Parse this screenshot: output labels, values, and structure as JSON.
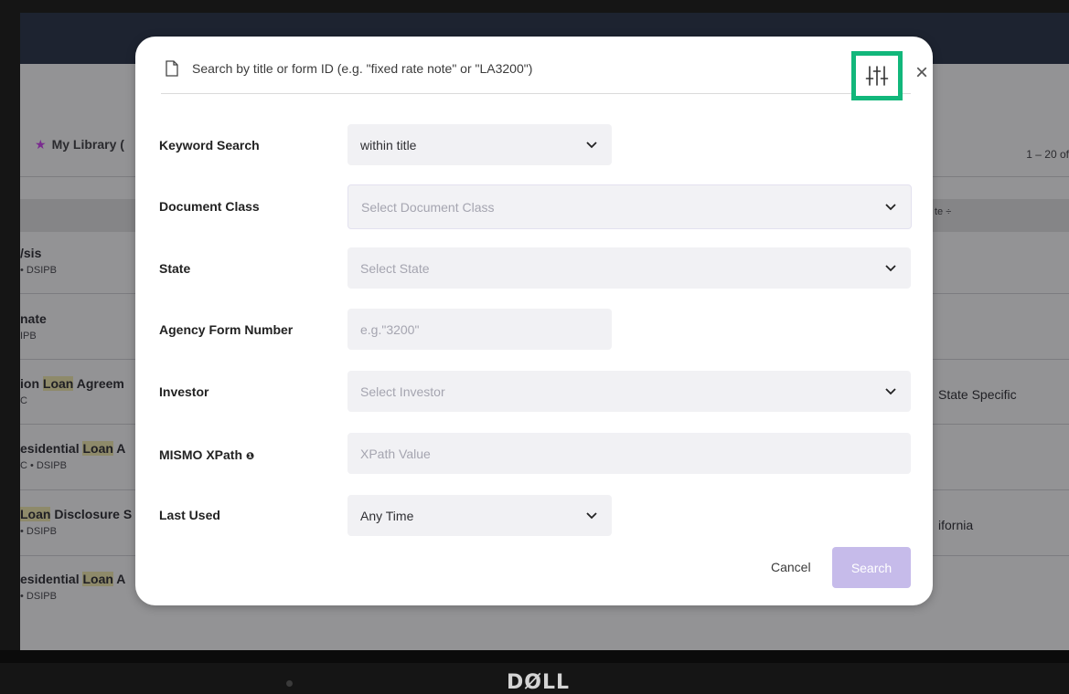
{
  "background": {
    "library_tab": {
      "star": "★",
      "label": "My Library ("
    },
    "pagination": "1 – 20 of",
    "column_header_right": "te ÷",
    "rows": [
      {
        "title_pre": "/sis",
        "title_hl": "",
        "title_post": "",
        "sub": "• DSIPB",
        "right": ""
      },
      {
        "title_pre": "nate",
        "title_hl": "",
        "title_post": "",
        "sub": "IPB",
        "right": ""
      },
      {
        "title_pre": "ion ",
        "title_hl": "Loan",
        "title_post": " Agreem",
        "sub": "C",
        "right": "State Specific"
      },
      {
        "title_pre": "esidential ",
        "title_hl": "Loan",
        "title_post": " A",
        "sub": "C • DSIPB",
        "right": ""
      },
      {
        "title_pre": "",
        "title_hl": "Loan",
        "title_post": " Disclosure S",
        "sub": "• DSIPB",
        "right": "ifornia"
      },
      {
        "title_pre": "esidential ",
        "title_hl": "Loan",
        "title_post": " A",
        "sub": "• DSIPB",
        "right": ""
      }
    ],
    "brand": "DØLL"
  },
  "modal": {
    "search_placeholder": "Search by title or form ID (e.g. \"fixed rate note\" or \"LA3200\")",
    "filter_icon": "sliders-icon",
    "close_icon": "×",
    "fields": {
      "keyword": {
        "label": "Keyword Search",
        "value": "within title"
      },
      "doc_class": {
        "label": "Document Class",
        "placeholder": "Select Document Class"
      },
      "state": {
        "label": "State",
        "placeholder": "Select State"
      },
      "agency": {
        "label": "Agency Form Number",
        "placeholder": "e.g.\"3200\""
      },
      "investor": {
        "label": "Investor",
        "placeholder": "Select Investor"
      },
      "mismo": {
        "label": "MISMO XPath",
        "info_icon": "❶",
        "placeholder": "XPath Value"
      },
      "last_used": {
        "label": "Last Used",
        "value": "Any Time"
      }
    },
    "cancel_label": "Cancel",
    "search_label": "Search"
  },
  "colors": {
    "filter_highlight": "#12b77b",
    "search_button": "#c6bbea",
    "star": "#7a2b8f"
  }
}
